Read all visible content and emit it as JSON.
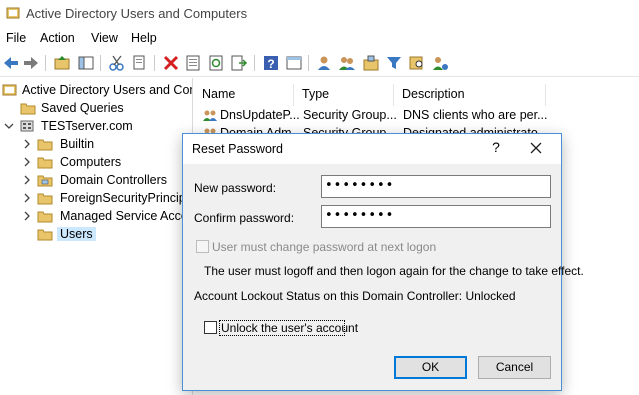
{
  "window": {
    "title": "Active Directory Users and Computers"
  },
  "menu": [
    "File",
    "Action",
    "View",
    "Help"
  ],
  "tree": {
    "root": "Active Directory Users and Com",
    "saved_queries": "Saved Queries",
    "domain": "TESTserver.com",
    "children": [
      "Builtin",
      "Computers",
      "Domain Controllers",
      "ForeignSecurityPrincipa",
      "Managed Service Accou",
      "Users"
    ],
    "selected": "Users"
  },
  "list": {
    "columns": [
      "Name",
      "Type",
      "Description"
    ],
    "rows": [
      {
        "name": "DnsUpdateP...",
        "type": "Security Group...",
        "description": "DNS clients who are per..."
      },
      {
        "name": "Domain Adm...",
        "type": "Security Group...",
        "description": "Designated administrato..."
      }
    ]
  },
  "dialog": {
    "title": "Reset Password",
    "help_glyph": "?",
    "new_password_label": "New password:",
    "new_password_value": "••••••••",
    "confirm_password_label": "Confirm password:",
    "confirm_password_value": "••••••••",
    "must_change_label": "User must change password at next logon",
    "must_change_checked": false,
    "must_change_enabled": false,
    "logoff_note": "The user must logoff and then logon again for the change to take effect.",
    "lockout_status": "Account Lockout Status on this Domain Controller: Unlocked",
    "unlock_label": "Unlock the user's account",
    "unlock_checked": false,
    "ok_label": "OK",
    "cancel_label": "Cancel"
  },
  "colors": {
    "accent": "#0078d7",
    "selection": "#cce8ff",
    "folder": "#e8c46a"
  }
}
